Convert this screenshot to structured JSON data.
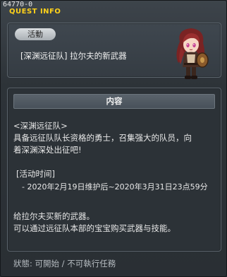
{
  "quest_id": "64770-0",
  "window_title": "QUEST INFO",
  "category": "活動",
  "quest_name": "[深渊远征队] 拉尔夫的新武器",
  "content_header": "内容",
  "body_lines": [
    "<深渊远征队>",
    "具备远征队队长资格的勇士，召集强大的队员，向",
    "着深渊深处出征吧!",
    "[活动时间]",
    "- 2020年2月19日维护后~2020年3月31日23点59分",
    "给拉尔夫买新的武器。",
    "可以通过远征队本部的宝宝购买武器与技能。"
  ],
  "status_text": "狀態: 可開始 / 不可執行任務",
  "colors": {
    "title": "#ffd21a",
    "avatar_hair": "#8e2b2b"
  },
  "icons": {
    "avatar": "npc-ralph-avatar"
  }
}
